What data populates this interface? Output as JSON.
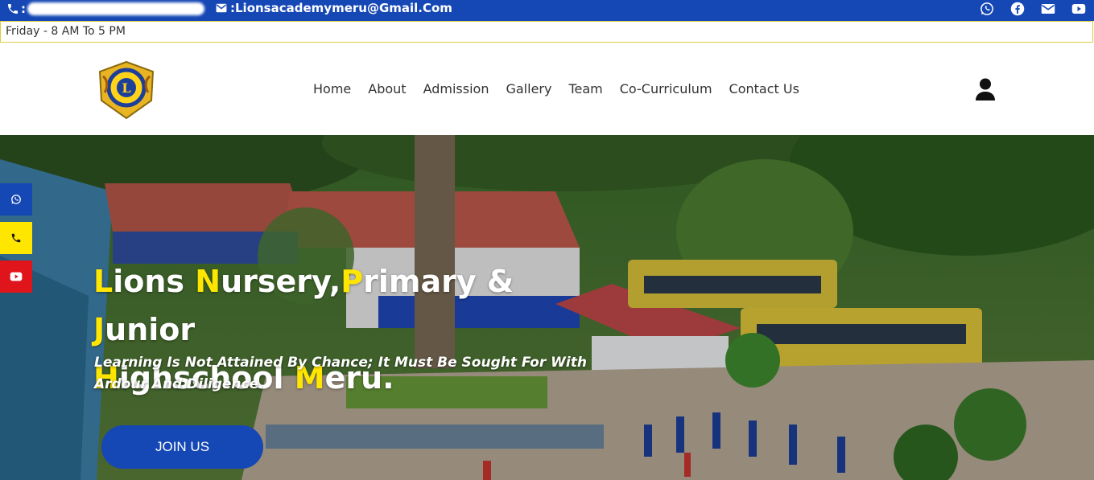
{
  "topbar": {
    "email": ":Lionsacademymeru@Gmail.Com",
    "socials": [
      "whatsapp-icon",
      "facebook-icon",
      "mail-icon",
      "youtube-icon"
    ]
  },
  "hours": {
    "text": "Friday - 8 AM To 5 PM"
  },
  "nav": {
    "items": [
      "Home",
      "About",
      "Admission",
      "Gallery",
      "Team",
      "Co-Curriculum",
      "Contact Us"
    ]
  },
  "hero": {
    "title_parts": [
      {
        "first": "L",
        "rest": "ions "
      },
      {
        "first": "N",
        "rest": "ursery,"
      },
      {
        "first": "P",
        "rest": "rimary & "
      },
      {
        "first": "J",
        "rest": "unior"
      },
      {
        "first": "H",
        "rest": "ighschool "
      },
      {
        "first": "M",
        "rest": "eru."
      }
    ],
    "subtitle": "Learning Is Not Attained By Chance; It Must Be Sought For With Ardour And Diligence.",
    "cta": "JOIN US"
  },
  "colors": {
    "brand_blue": "#1547b5",
    "accent_yellow": "#ffe600",
    "youtube_red": "#e0141b"
  }
}
